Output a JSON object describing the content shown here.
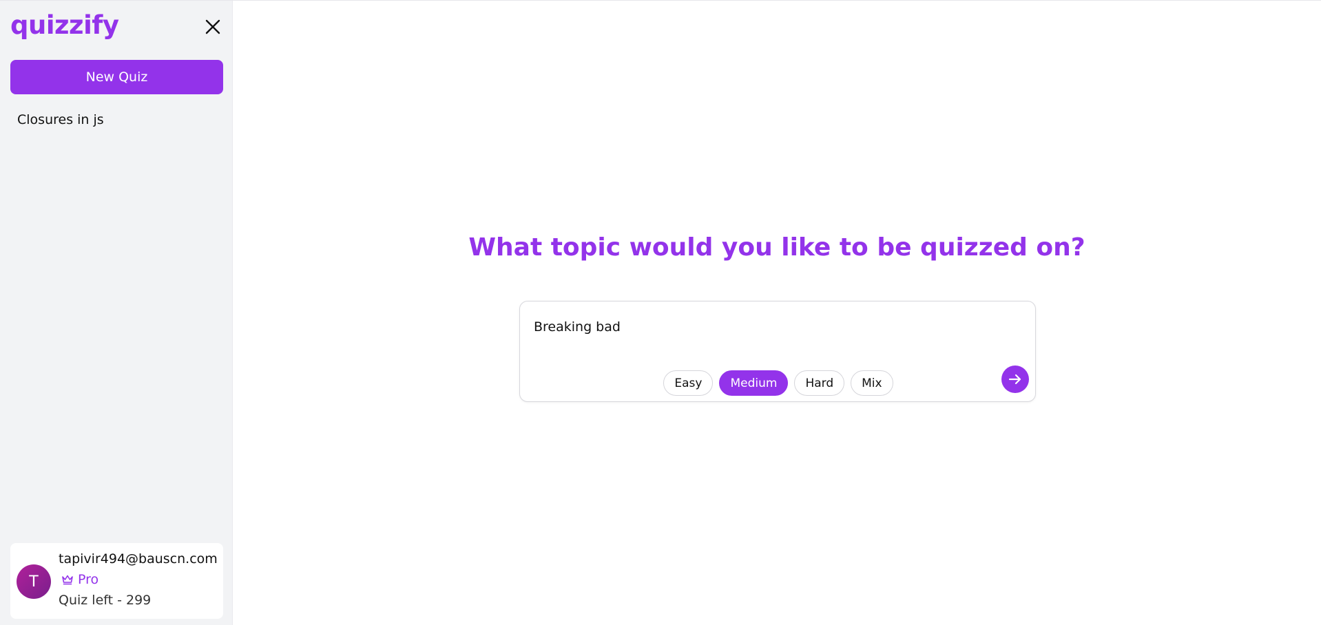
{
  "app": {
    "logo": "quizzify",
    "accent_color": "#9333ea"
  },
  "sidebar": {
    "close_icon": "close-icon",
    "new_quiz_label": "New Quiz",
    "history": [
      {
        "label": "Closures in js"
      }
    ],
    "user": {
      "avatar_initial": "T",
      "email": "tapivir494@bauscn.com",
      "plan_icon": "crown-icon",
      "plan": "Pro",
      "quota": "Quiz left - 299"
    }
  },
  "main": {
    "heading": "What topic would you like to be quizzed on?",
    "topic_value": "Breaking bad",
    "difficulty_options": [
      {
        "label": "Easy",
        "selected": false
      },
      {
        "label": "Medium",
        "selected": true
      },
      {
        "label": "Hard",
        "selected": false
      },
      {
        "label": "Mix",
        "selected": false
      }
    ],
    "submit_icon": "arrow-right-icon"
  }
}
